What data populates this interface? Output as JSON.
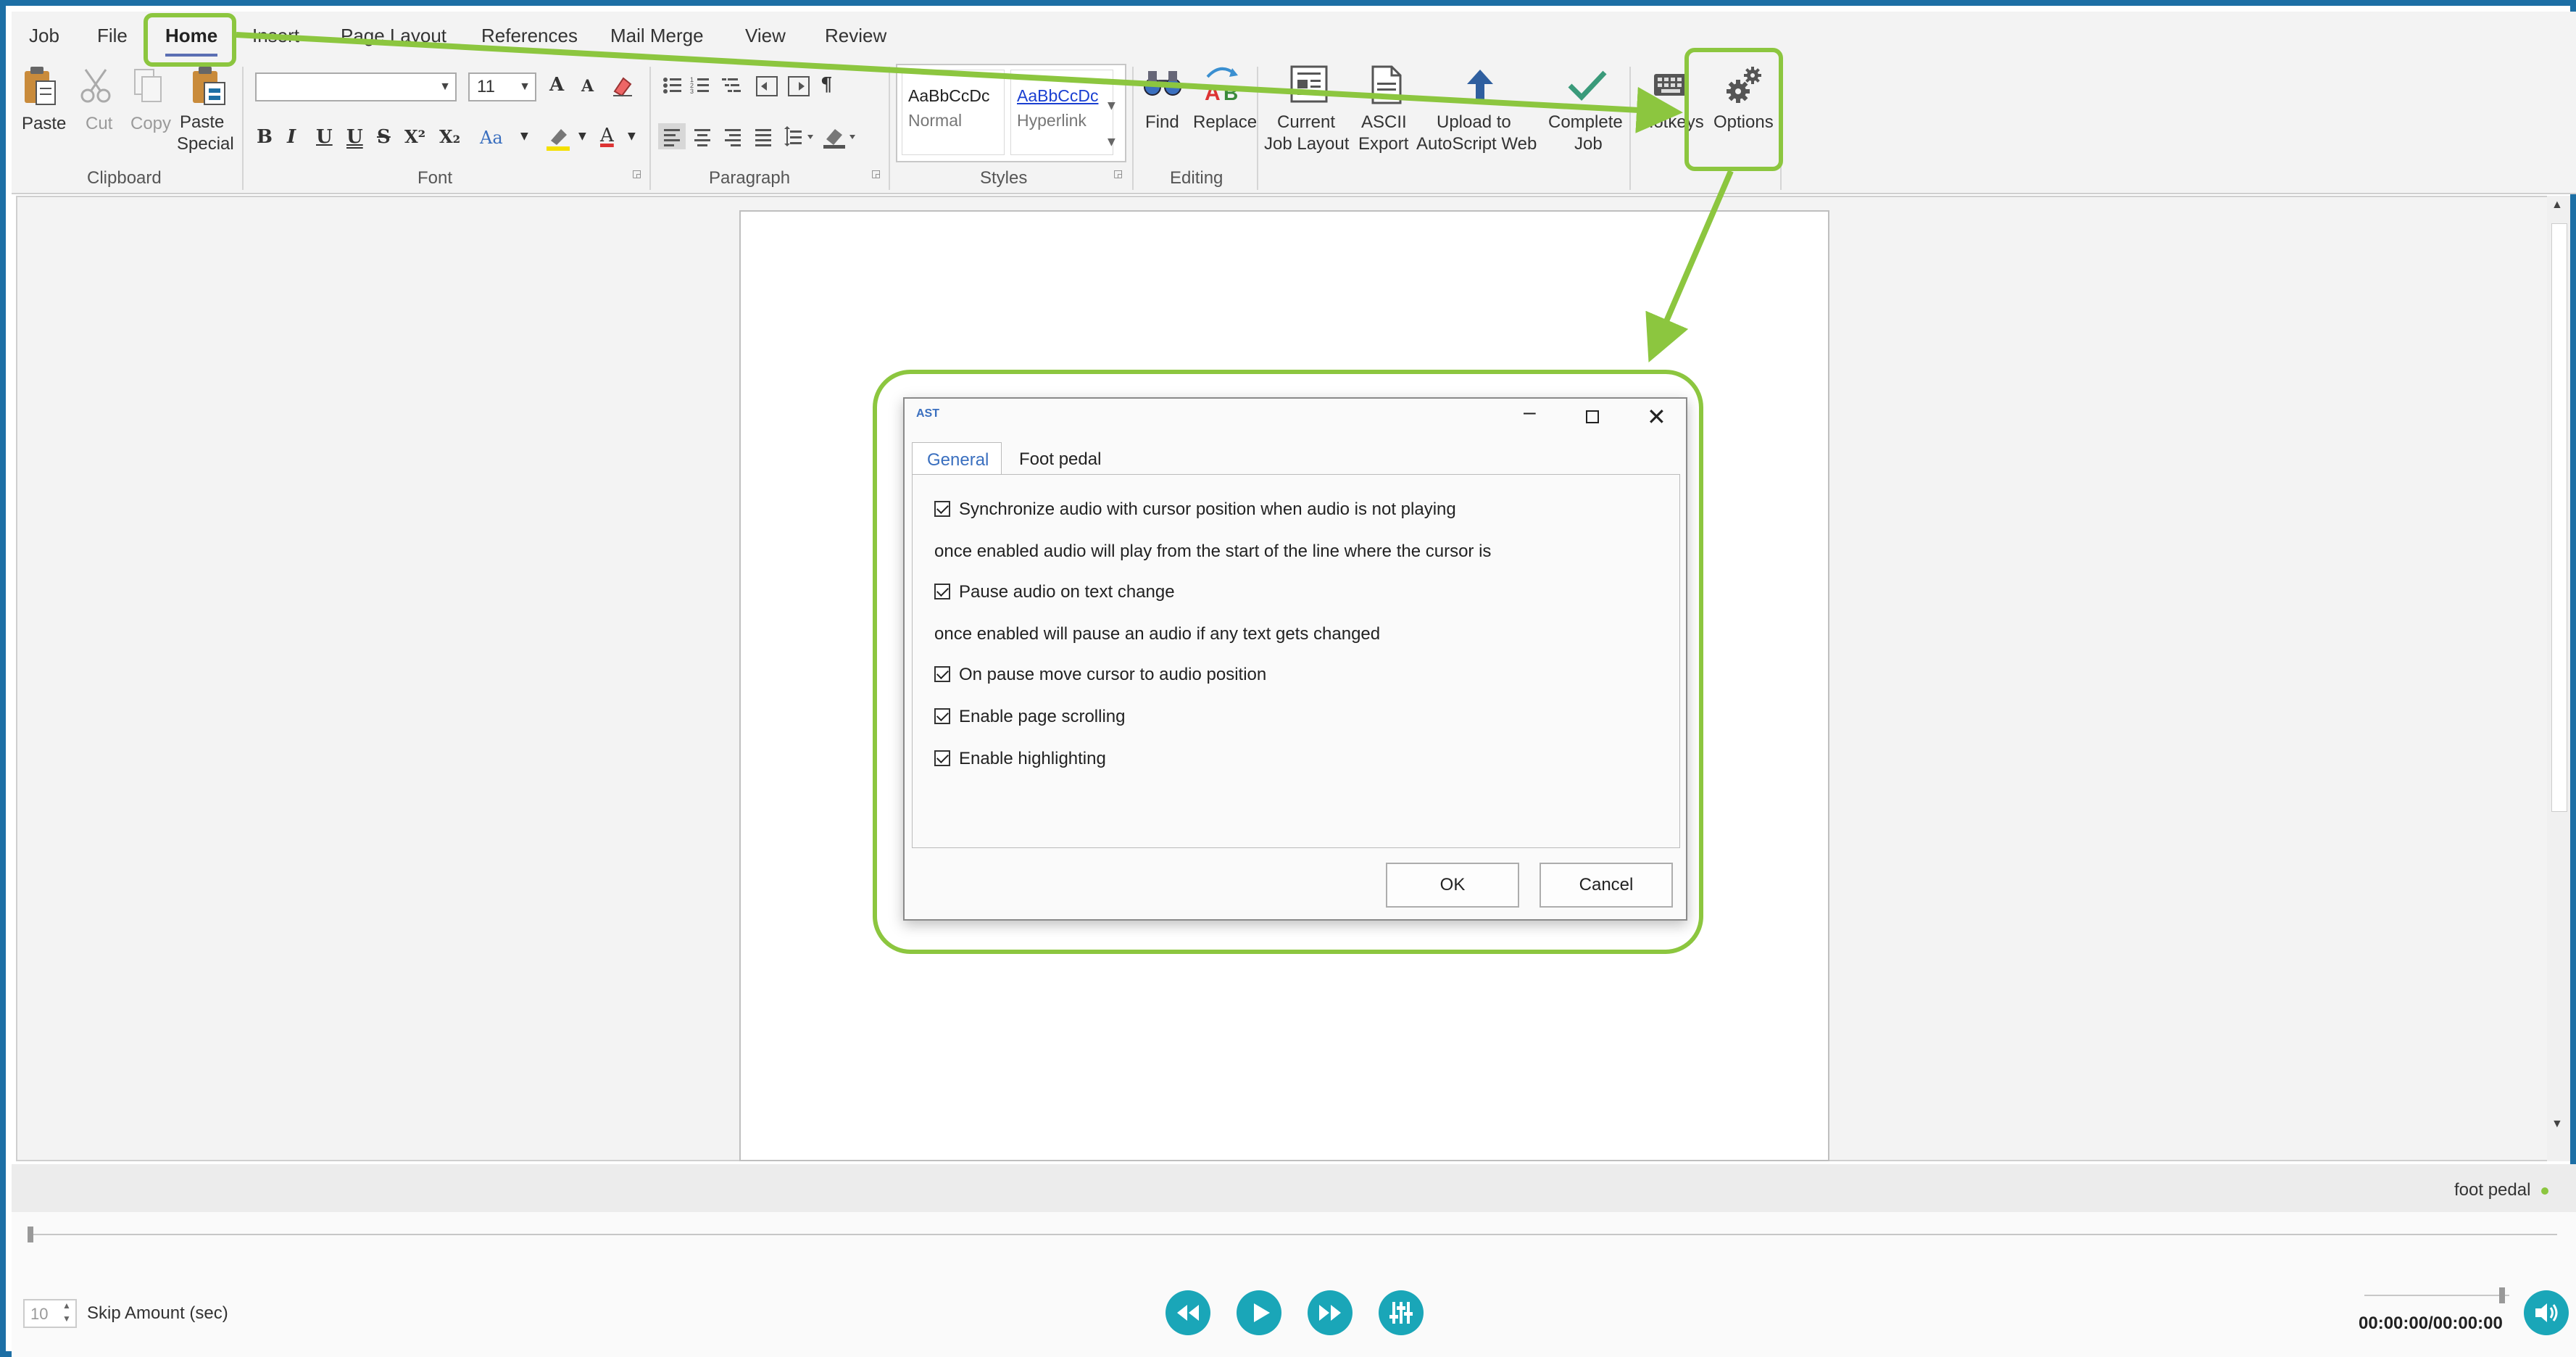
{
  "menu": {
    "items": [
      "Job",
      "File",
      "Home",
      "Insert",
      "Page Layout",
      "References",
      "Mail Merge",
      "View",
      "Review"
    ],
    "active": "Home"
  },
  "ribbon": {
    "clipboard": {
      "group_label": "Clipboard",
      "paste": "Paste",
      "cut": "Cut",
      "copy": "Copy",
      "paste_special_1": "Paste",
      "paste_special_2": "Special"
    },
    "font": {
      "group_label": "Font",
      "font_name": "",
      "font_size": "11",
      "grow": "A",
      "shrink": "A",
      "bold": "B",
      "italic": "I",
      "underline": "U",
      "double_underline": "U",
      "strike": "S",
      "superscript": "X²",
      "subscript": "X₂",
      "change_case": "Aa",
      "font_color": "A"
    },
    "paragraph": {
      "group_label": "Paragraph",
      "pilcrow": "¶"
    },
    "styles": {
      "group_label": "Styles",
      "normal_preview": "AaBbCcDc",
      "normal_name": "Normal",
      "hyperlink_preview": "AaBbCcDc",
      "hyperlink_name": "Hyperlink"
    },
    "editing": {
      "group_label": "Editing",
      "find": "Find",
      "replace": "Replace"
    },
    "custom": {
      "current_job_layout_1": "Current",
      "current_job_layout_2": "Job Layout",
      "ascii_export_1": "ASCII",
      "ascii_export_2": "Export",
      "upload_1": "Upload to",
      "upload_2": "AutoScript Web",
      "complete_job_1": "Complete",
      "complete_job_2": "Job",
      "hotkeys": "Hotkeys",
      "options": "Options"
    }
  },
  "dialog": {
    "app_icon_text": "AST",
    "tabs": [
      "General",
      "Foot pedal"
    ],
    "active_tab": "General",
    "options": [
      {
        "label": "Synchronize audio with cursor position when audio is not playing",
        "checked": true
      },
      {
        "note": "once enabled audio will play from the start of the line where the cursor is"
      },
      {
        "label": "Pause audio on text change",
        "checked": true
      },
      {
        "note": "once enabled will pause an audio if any text gets changed"
      },
      {
        "label": "On pause move cursor to audio position",
        "checked": true
      },
      {
        "label": "Enable page scrolling",
        "checked": true
      },
      {
        "label": "Enable highlighting",
        "checked": true
      }
    ],
    "ok": "OK",
    "cancel": "Cancel"
  },
  "status": {
    "foot_pedal": "foot pedal"
  },
  "player": {
    "skip_value": "10",
    "skip_label": "Skip Amount (sec)",
    "time": "00:00:00/00:00:00",
    "volume_level": 0.95
  },
  "colors": {
    "accent_green": "#8cc63f",
    "border_blue": "#1d6fa5",
    "player_teal": "#1aa6b8",
    "active_tab_underline": "#5b6fb3"
  }
}
